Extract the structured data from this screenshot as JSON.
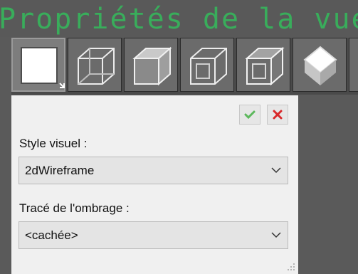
{
  "title": "Propriétés de la vue",
  "toolbar": {
    "buttons": [
      {
        "icon": "2d-wireframe-icon",
        "active": true
      },
      {
        "icon": "3d-wireframe-icon",
        "active": false
      },
      {
        "icon": "shaded-cube-icon",
        "active": false
      },
      {
        "icon": "hidden-cube-icon",
        "active": false
      },
      {
        "icon": "conceptual-cube-icon",
        "active": false
      },
      {
        "icon": "realistic-cube-icon",
        "active": false
      }
    ]
  },
  "actions": {
    "ok_icon": "checkmark-icon",
    "cancel_icon": "close-icon",
    "ok_color": "#5cb85c",
    "cancel_color": "#d9292b"
  },
  "form": {
    "visual_style_label": "Style visuel :",
    "visual_style_value": "2dWireframe",
    "shadow_label": "Tracé de l'ombrage :",
    "shadow_value": "<cachée>"
  },
  "colors": {
    "title": "#39ad5b",
    "background": "#5a5a5a",
    "panel": "#f0f0f0"
  }
}
